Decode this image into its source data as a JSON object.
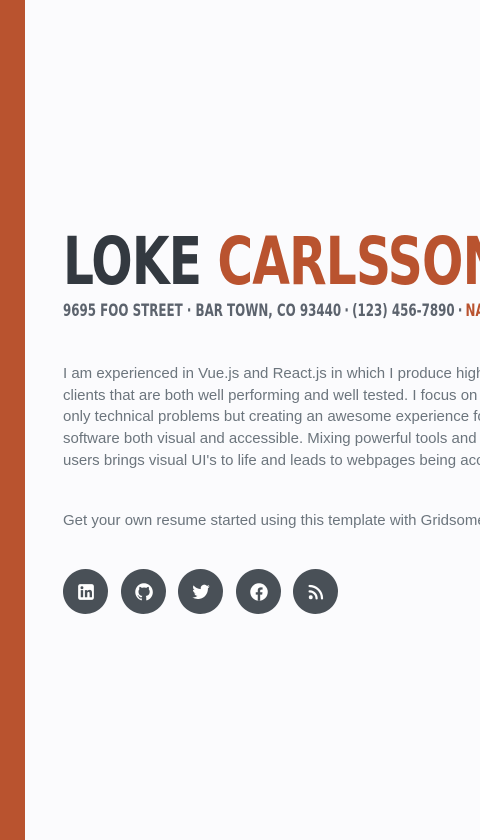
{
  "colors": {
    "accent": "#b9532f",
    "dark": "#333940",
    "text_muted": "#6c757d",
    "icon_bg": "#495057"
  },
  "profile": {
    "first_name": "LOKE",
    "last_name": "CARLSSON",
    "address": "9695 FOO STREET · BAR TOWN, CO 93440",
    "separator": "·",
    "phone": "(123) 456-7890",
    "email": "NAME@EMAIL.COM"
  },
  "bio": {
    "lines": [
      "I am experienced in Vue.js and React.js in which I produce high quality",
      "clients that are both well performing and well tested. I focus on solving",
      "only technical problems but creating an awesome experience for users with",
      "software both visual and accessible. Mixing powerful tools and thoughts for",
      "users brings visual UI's to life and leads to webpages being accessible."
    ]
  },
  "cta": "Get your own resume started using this template with Gridsome",
  "social": [
    {
      "icon": "linkedin-icon"
    },
    {
      "icon": "github-icon"
    },
    {
      "icon": "twitter-icon"
    },
    {
      "icon": "facebook-icon"
    },
    {
      "icon": "rss-icon"
    }
  ]
}
